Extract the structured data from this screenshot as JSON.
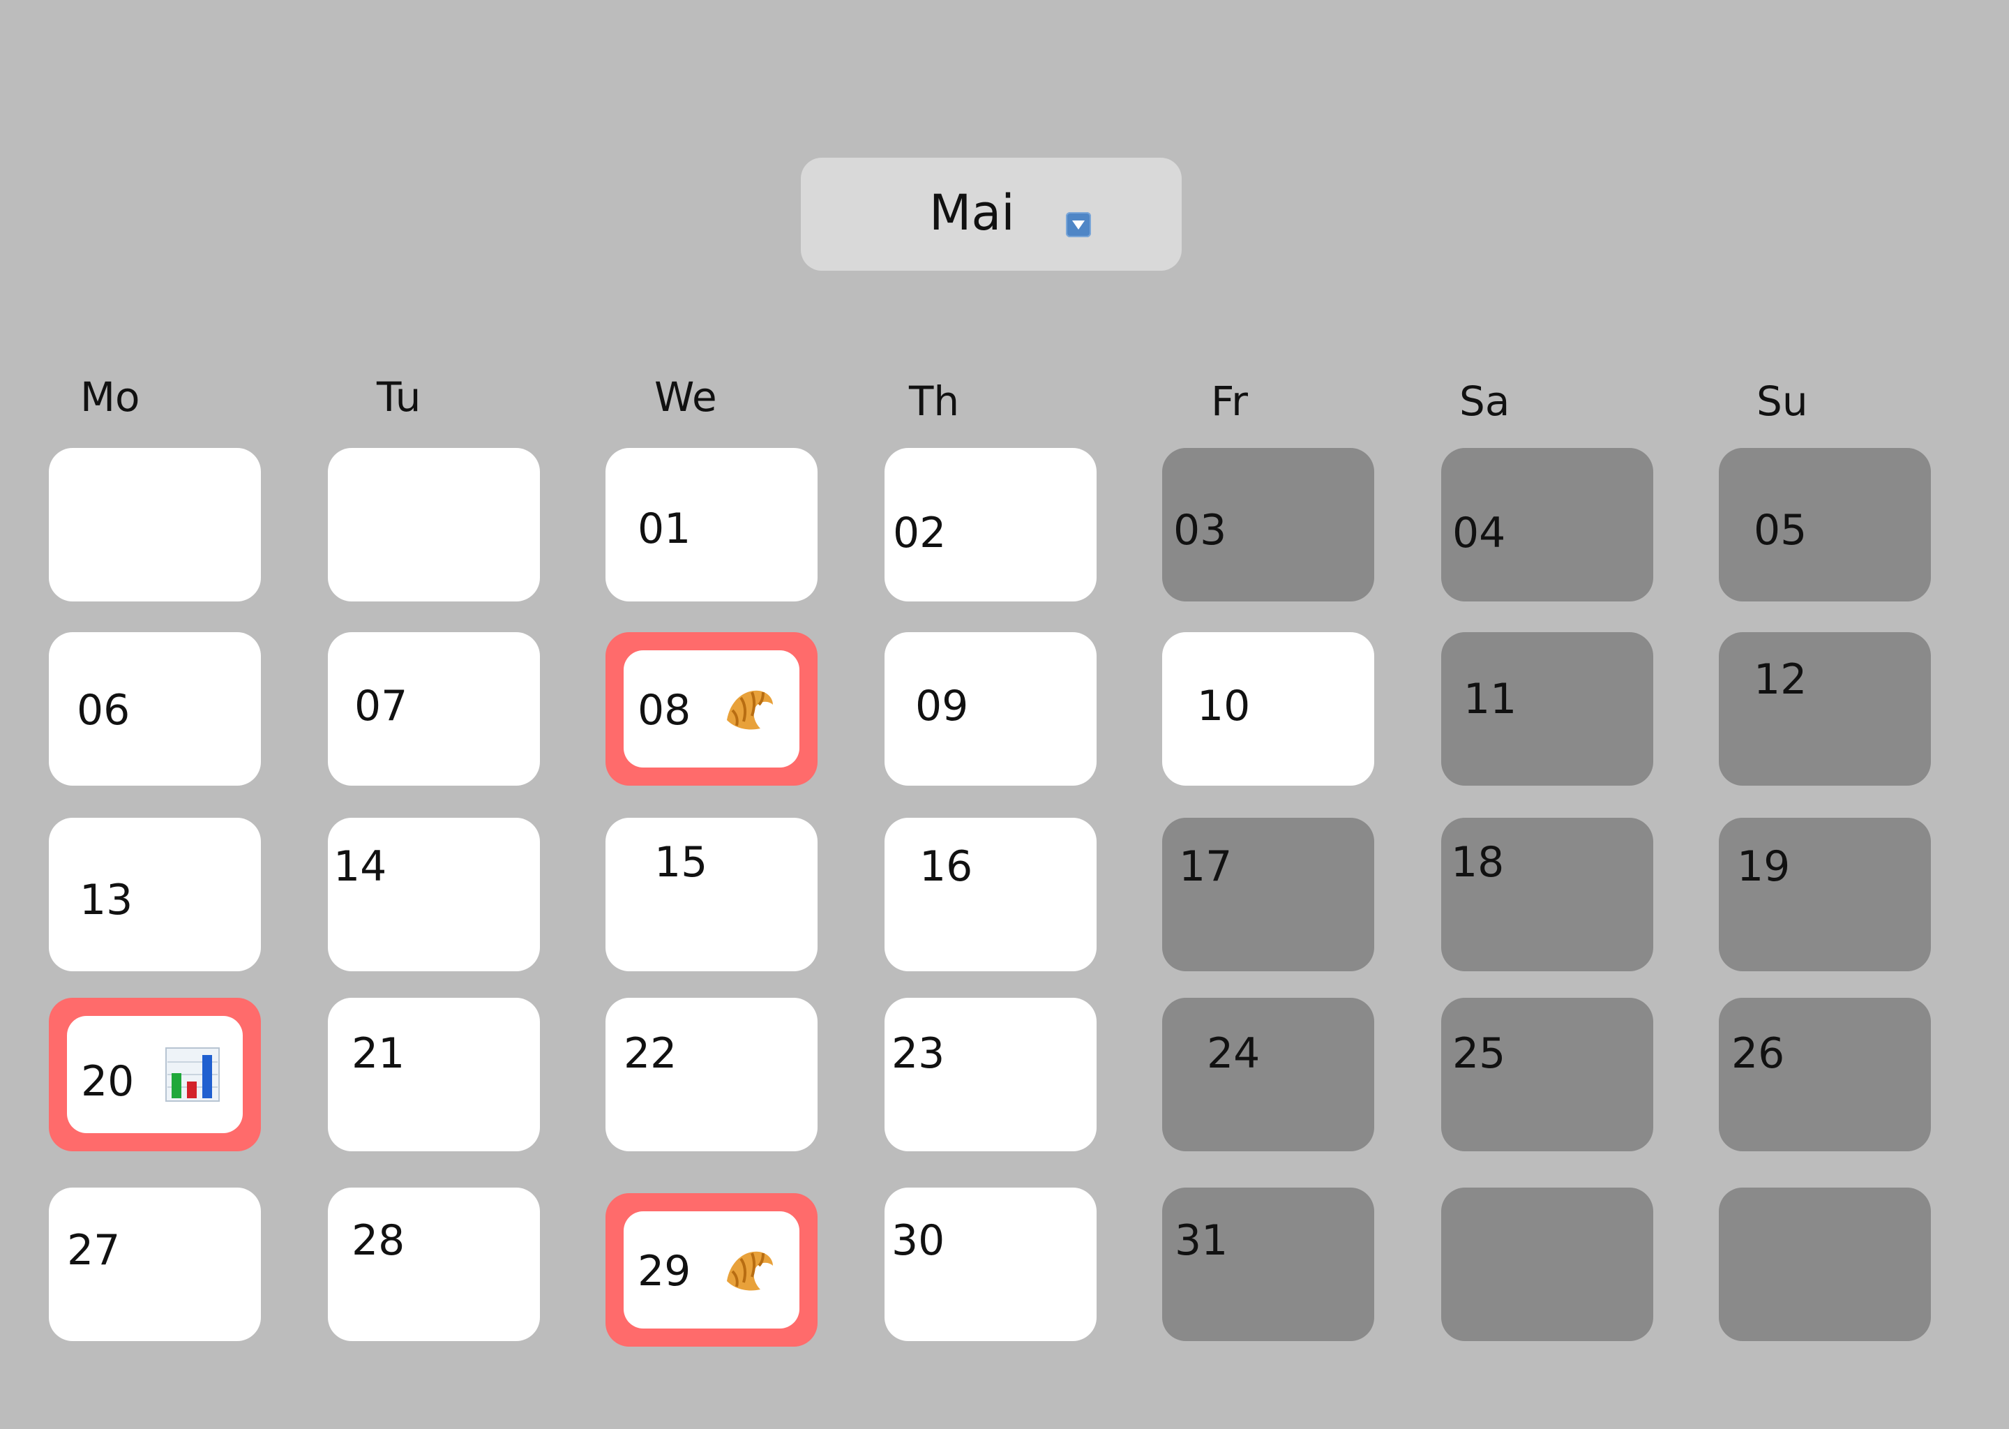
{
  "month_selector": {
    "label": "Mai",
    "icon": "dropdown-triangle-icon"
  },
  "weekdays": [
    "Mo",
    "Tu",
    "We",
    "Th",
    "Fr",
    "Sa",
    "Su"
  ],
  "days": {
    "r0": [
      "",
      "",
      "01",
      "02",
      "03",
      "04",
      "05"
    ],
    "r1": [
      "06",
      "07",
      "08",
      "09",
      "10",
      "11",
      "12"
    ],
    "r2": [
      "13",
      "14",
      "15",
      "16",
      "17",
      "18",
      "19"
    ],
    "r3": [
      "20",
      "21",
      "22",
      "23",
      "24",
      "25",
      "26"
    ],
    "r4": [
      "27",
      "28",
      "29",
      "30",
      "31",
      "",
      ""
    ]
  },
  "events": [
    {
      "day": "08",
      "icon": "croissant-icon"
    },
    {
      "day": "20",
      "icon": "bar-chart-icon"
    },
    {
      "day": "29",
      "icon": "croissant-icon"
    }
  ],
  "colors": {
    "background": "#bcbcbc",
    "day_cell": "#ffffff",
    "weekend_cell": "#8a8a8a",
    "event_highlight": "#ff6b6b",
    "selector": "#d9d9d9"
  }
}
